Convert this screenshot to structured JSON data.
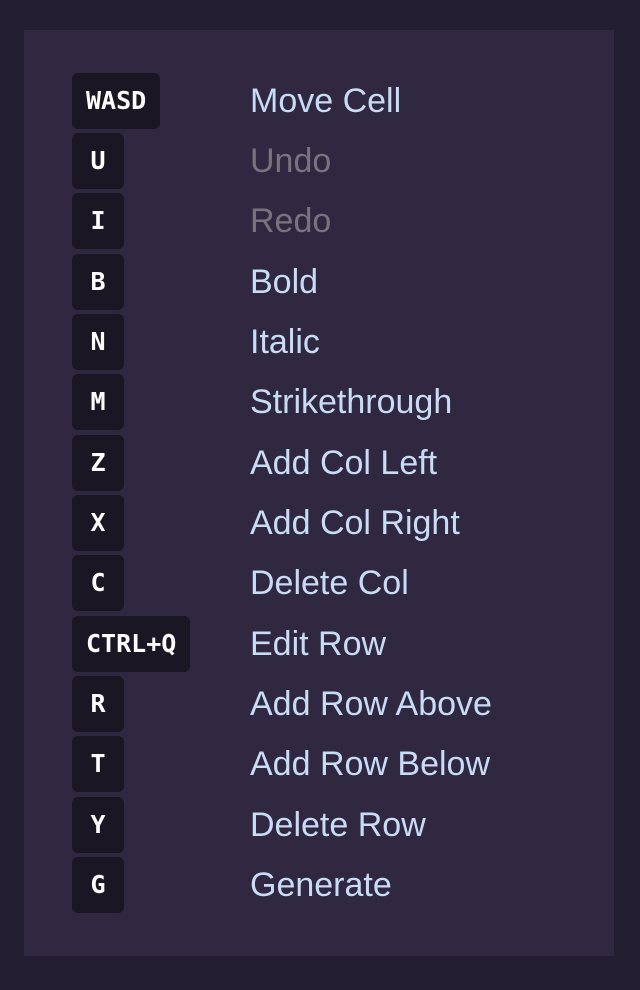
{
  "shortcuts": [
    {
      "key": "WASD",
      "label": "Move Cell",
      "disabled": false
    },
    {
      "key": "U",
      "label": "Undo",
      "disabled": true
    },
    {
      "key": "I",
      "label": "Redo",
      "disabled": true
    },
    {
      "key": "B",
      "label": "Bold",
      "disabled": false
    },
    {
      "key": "N",
      "label": "Italic",
      "disabled": false
    },
    {
      "key": "M",
      "label": "Strikethrough",
      "disabled": false
    },
    {
      "key": "Z",
      "label": "Add Col Left",
      "disabled": false
    },
    {
      "key": "X",
      "label": "Add Col Right",
      "disabled": false
    },
    {
      "key": "C",
      "label": "Delete Col",
      "disabled": false
    },
    {
      "key": "CTRL+Q",
      "label": "Edit Row",
      "disabled": false
    },
    {
      "key": "R",
      "label": "Add Row Above",
      "disabled": false
    },
    {
      "key": "T",
      "label": "Add Row Below",
      "disabled": false
    },
    {
      "key": "Y",
      "label": "Delete Row",
      "disabled": false
    },
    {
      "key": "G",
      "label": "Generate",
      "disabled": false
    }
  ],
  "colors": {
    "background": "#241e32",
    "panel": "#302841",
    "key_background": "#1a1624",
    "label_enabled": "#c8dcf6",
    "label_disabled": "#79737f"
  }
}
